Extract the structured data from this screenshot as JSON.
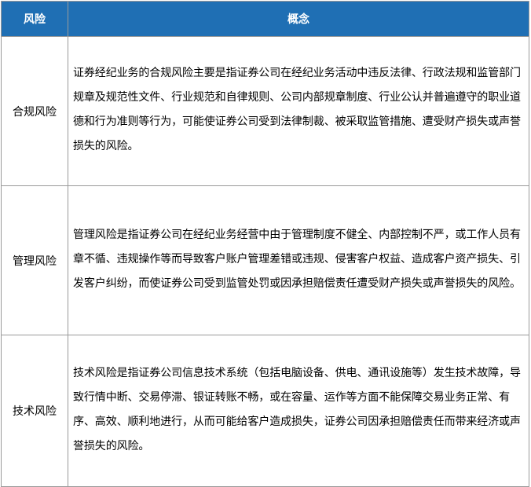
{
  "table": {
    "headers": {
      "risk": "风险",
      "concept": "概念"
    },
    "rows": [
      {
        "risk": "合规风险",
        "concept": "证券经纪业务的合规风险主要是指证券公司在经纪业务活动中违反法律、行政法规和监管部门规章及规范性文件、行业规范和自律规则、公司内部规章制度、行业公认并普遍遵守的职业道德和行为准则等行为，可能使证券公司受到法律制裁、被采取监管措施、遭受财产损失或声誉损失的风险。"
      },
      {
        "risk": "管理风险",
        "concept": "管理风险是指证券公司在经纪业务经营中由于管理制度不健全、内部控制不严，或工作人员有章不循、违规操作等而导致客户账户管理差错或违规、侵害客户权益、造成客户资产损失、引发客户纠纷，而使证券公司受到监管处罚或因承担赔偿责任遭受财产损失或声誉损失的风险。"
      },
      {
        "risk": "技术风险",
        "concept": "技术风险是指证券公司信息技术系统（包括电脑设备、供电、通讯设施等）发生技术故障，导致行情中断、交易停滞、银证转账不畅，或在容量、运作等方面不能保障交易业务正常、有序、高效、顺利地进行，从而可能给客户造成损失，证券公司因承担赔偿责任而带来经济或声誉损失的风险。"
      }
    ]
  }
}
